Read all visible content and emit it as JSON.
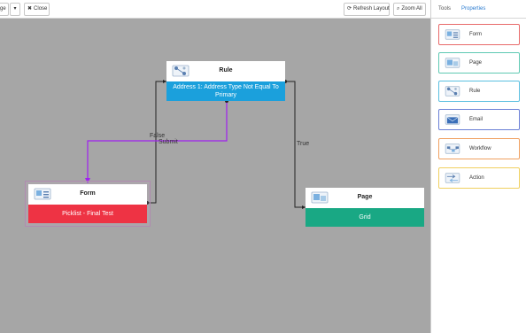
{
  "toolbar": {
    "page_btn_label": "ge",
    "dropdown_glyph": "▾",
    "close_label": "Close",
    "close_icon": "✖",
    "refresh_label": "Refresh Layout",
    "refresh_icon": "⟳",
    "zoom_label": "Zoom All",
    "zoom_icon": "⌕"
  },
  "canvas": {
    "background": "#a6a6a6",
    "nodes": {
      "rule": {
        "title": "Rule",
        "body": "Address 1: Address Type Not Equal To Primary",
        "color": "#1ba0dc"
      },
      "form": {
        "title": "Form",
        "body": "Picklist - Final Test",
        "color": "#ee3344"
      },
      "page": {
        "title": "Page",
        "body": "Grid",
        "color": "#19a884"
      }
    },
    "connections": {
      "false_label": "False",
      "submit_label": "Submit",
      "true_label": "True",
      "highlight_color": "#a020f0"
    }
  },
  "panel": {
    "tabs": {
      "tools": "Tools",
      "properties": "Properties"
    },
    "tools": [
      {
        "label": "Form",
        "border": "#e86a6a"
      },
      {
        "label": "Page",
        "border": "#5fc9b3"
      },
      {
        "label": "Rule",
        "border": "#5bbfe0"
      },
      {
        "label": "Email",
        "border": "#6a7fd6"
      },
      {
        "label": "Workflow",
        "border": "#f0a060"
      },
      {
        "label": "Action",
        "border": "#f0d060"
      }
    ]
  }
}
